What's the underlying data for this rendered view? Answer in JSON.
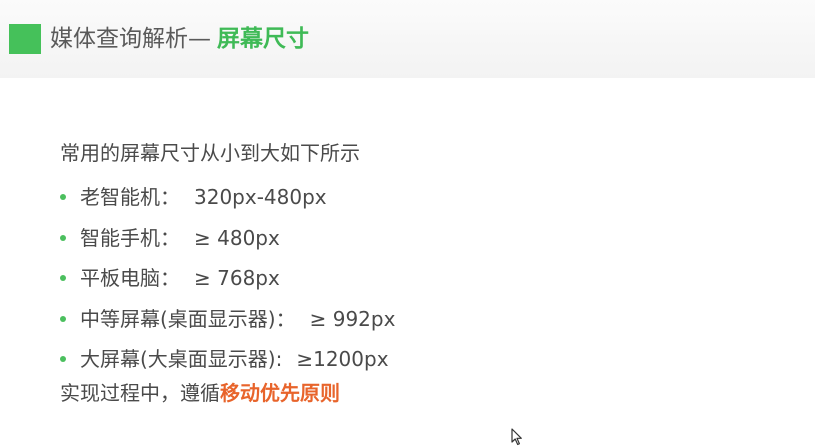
{
  "title": {
    "prefix": "媒体查询解析—",
    "highlight": "屏幕尺寸"
  },
  "content": {
    "intro": "常用的屏幕尺寸从小到大如下所示",
    "items": [
      {
        "label": "老智能机：",
        "value": "320px-480px"
      },
      {
        "label": "智能手机：",
        "value": "≥ 480px"
      },
      {
        "label": "平板电脑：",
        "value": "≥ 768px"
      },
      {
        "label": "中等屏幕(桌面显示器)：",
        "value": "≥ 992px"
      },
      {
        "label": "大屏幕(大桌面显示器):",
        "value": "≥1200px"
      }
    ],
    "footer_prefix": "实现过程中，遵循",
    "footer_highlight": "移动优先原则"
  },
  "colors": {
    "accent_green": "#45c15a",
    "highlight_orange": "#e8642b",
    "text": "#4a4a4a"
  },
  "icons": {
    "title_marker": "green-square-icon",
    "bullet": "green-dot-icon",
    "cursor": "mouse-pointer-icon"
  }
}
